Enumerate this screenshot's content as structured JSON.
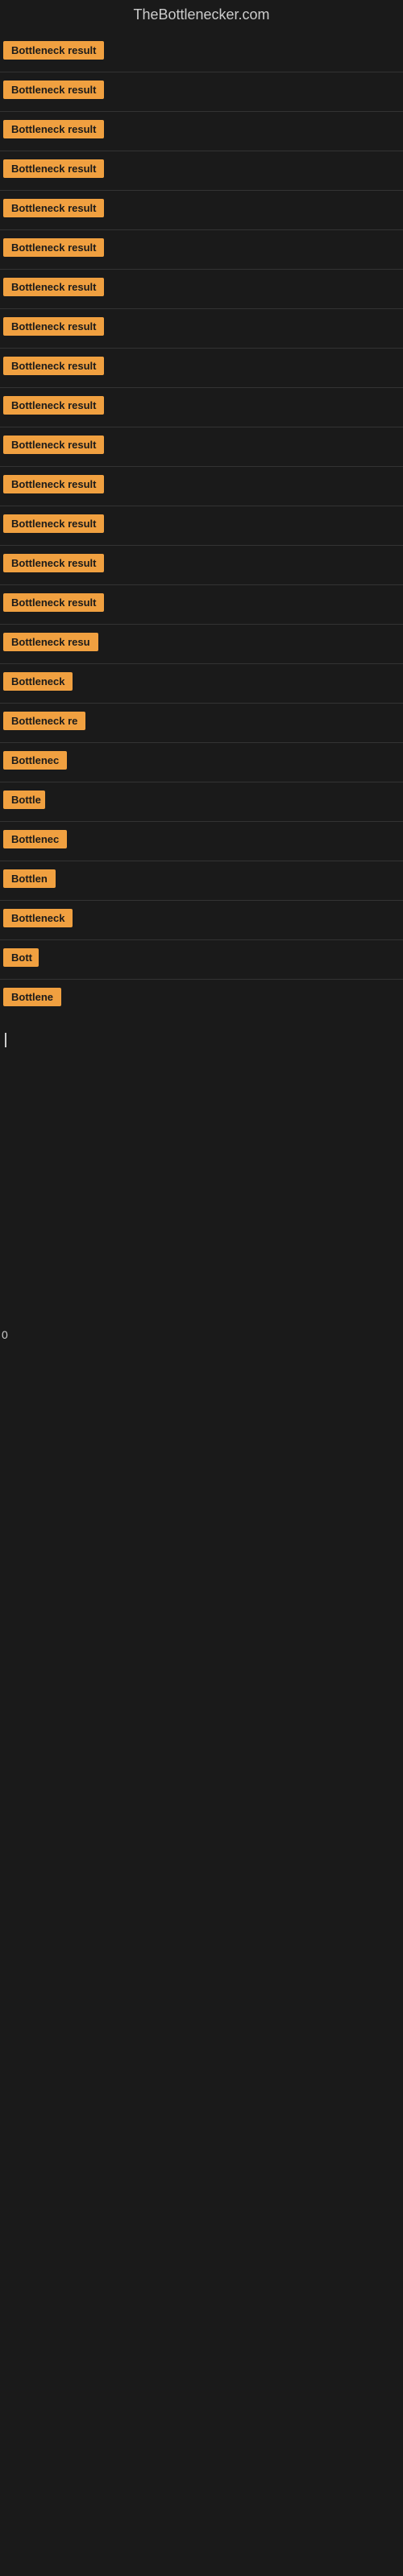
{
  "site": {
    "title": "TheBottlenecker.com"
  },
  "items": [
    {
      "id": 1,
      "label": "Bottleneck result",
      "width": "full"
    },
    {
      "id": 2,
      "label": "Bottleneck result",
      "width": "full"
    },
    {
      "id": 3,
      "label": "Bottleneck result",
      "width": "full"
    },
    {
      "id": 4,
      "label": "Bottleneck result",
      "width": "full"
    },
    {
      "id": 5,
      "label": "Bottleneck result",
      "width": "full"
    },
    {
      "id": 6,
      "label": "Bottleneck result",
      "width": "full"
    },
    {
      "id": 7,
      "label": "Bottleneck result",
      "width": "full"
    },
    {
      "id": 8,
      "label": "Bottleneck result",
      "width": "full"
    },
    {
      "id": 9,
      "label": "Bottleneck result",
      "width": "full"
    },
    {
      "id": 10,
      "label": "Bottleneck result",
      "width": "full"
    },
    {
      "id": 11,
      "label": "Bottleneck result",
      "width": "full"
    },
    {
      "id": 12,
      "label": "Bottleneck result",
      "width": "full"
    },
    {
      "id": 13,
      "label": "Bottleneck result",
      "width": "full"
    },
    {
      "id": 14,
      "label": "Bottleneck result",
      "width": "full"
    },
    {
      "id": 15,
      "label": "Bottleneck result",
      "width": "full"
    },
    {
      "id": 16,
      "label": "Bottleneck resu",
      "width": "clipped1"
    },
    {
      "id": 17,
      "label": "Bottleneck",
      "width": "clipped2"
    },
    {
      "id": 18,
      "label": "Bottleneck re",
      "width": "clipped3"
    },
    {
      "id": 19,
      "label": "Bottlenec",
      "width": "clipped4"
    },
    {
      "id": 20,
      "label": "Bottle",
      "width": "clipped5"
    },
    {
      "id": 21,
      "label": "Bottlenec",
      "width": "clipped4"
    },
    {
      "id": 22,
      "label": "Bottlen",
      "width": "clipped6"
    },
    {
      "id": 23,
      "label": "Bottleneck",
      "width": "clipped2"
    },
    {
      "id": 24,
      "label": "Bott",
      "width": "clipped7"
    },
    {
      "id": 25,
      "label": "Bottlene",
      "width": "clipped8"
    }
  ],
  "cursor": true,
  "bottom_char": "0"
}
